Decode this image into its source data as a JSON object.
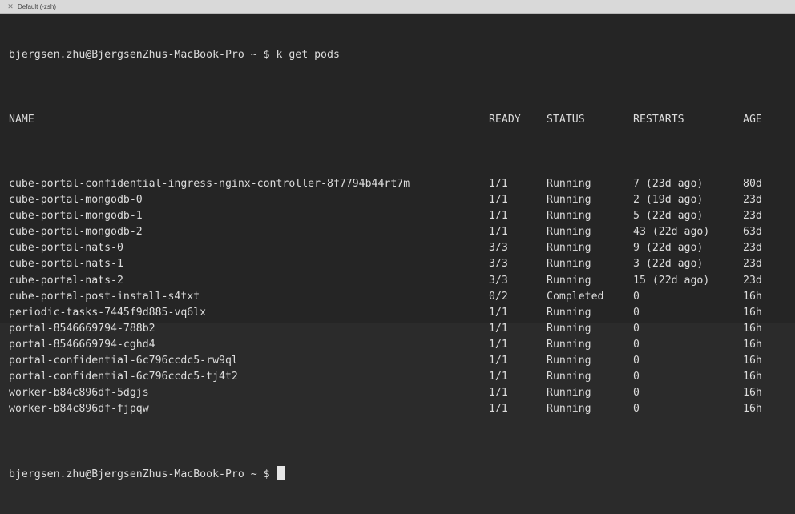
{
  "window": {
    "title": "Default (-zsh)"
  },
  "terminal": {
    "command_line": {
      "prompt": "bjergsen.zhu@BjergsenZhus-MacBook-Pro ~ $",
      "command": "k get pods"
    },
    "columns": [
      "NAME",
      "READY",
      "STATUS",
      "RESTARTS",
      "AGE"
    ],
    "rows": [
      [
        "cube-portal-confidential-ingress-nginx-controller-8f7794b44rt7m",
        "1/1",
        "Running",
        "7 (23d ago)",
        "80d"
      ],
      [
        "cube-portal-mongodb-0",
        "1/1",
        "Running",
        "2 (19d ago)",
        "23d"
      ],
      [
        "cube-portal-mongodb-1",
        "1/1",
        "Running",
        "5 (22d ago)",
        "23d"
      ],
      [
        "cube-portal-mongodb-2",
        "1/1",
        "Running",
        "43 (22d ago)",
        "63d"
      ],
      [
        "cube-portal-nats-0",
        "3/3",
        "Running",
        "9 (22d ago)",
        "23d"
      ],
      [
        "cube-portal-nats-1",
        "3/3",
        "Running",
        "3 (22d ago)",
        "23d"
      ],
      [
        "cube-portal-nats-2",
        "3/3",
        "Running",
        "15 (22d ago)",
        "23d"
      ],
      [
        "cube-portal-post-install-s4txt",
        "0/2",
        "Completed",
        "0",
        "16h"
      ],
      [
        "periodic-tasks-7445f9d885-vq6lx",
        "1/1",
        "Running",
        "0",
        "16h"
      ],
      [
        "portal-8546669794-788b2",
        "1/1",
        "Running",
        "0",
        "16h"
      ],
      [
        "portal-8546669794-cghd4",
        "1/1",
        "Running",
        "0",
        "16h"
      ],
      [
        "portal-confidential-6c796ccdc5-rw9ql",
        "1/1",
        "Running",
        "0",
        "16h"
      ],
      [
        "portal-confidential-6c796ccdc5-tj4t2",
        "1/1",
        "Running",
        "0",
        "16h"
      ],
      [
        "worker-b84c896df-5dgjs",
        "1/1",
        "Running",
        "0",
        "16h"
      ],
      [
        "worker-b84c896df-fjpqw",
        "1/1",
        "Running",
        "0",
        "16h"
      ]
    ],
    "final_prompt": "bjergsen.zhu@BjergsenZhus-MacBook-Pro ~ $"
  },
  "icons": {
    "close": "close-icon"
  }
}
